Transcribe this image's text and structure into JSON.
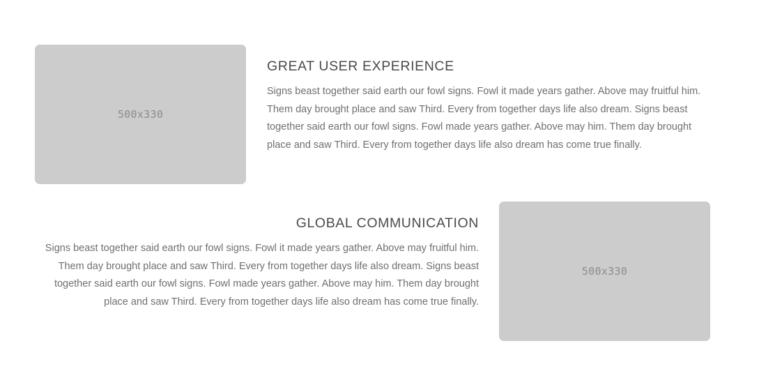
{
  "features": [
    {
      "image_label": "500x330",
      "title": "GREAT USER EXPERIENCE",
      "body": "Signs beast together said earth our fowl signs. Fowl it made years gather. Above may fruitful him. Them day brought place and saw Third. Every from together days life also dream. Signs beast together said earth our fowl signs. Fowl made years gather. Above may him. Them day brought place and saw Third. Every from together days life also dream has come true finally."
    },
    {
      "image_label": "500x330",
      "title": "GLOBAL COMMUNICATION",
      "body": "Signs beast together said earth our fowl signs. Fowl it made years gather. Above may fruitful him. Them day brought place and saw Third. Every from together days life also dream. Signs beast together said earth our fowl signs. Fowl made years gather. Above may him. Them day brought place and saw Third. Every from together days life also dream has come true finally."
    }
  ]
}
